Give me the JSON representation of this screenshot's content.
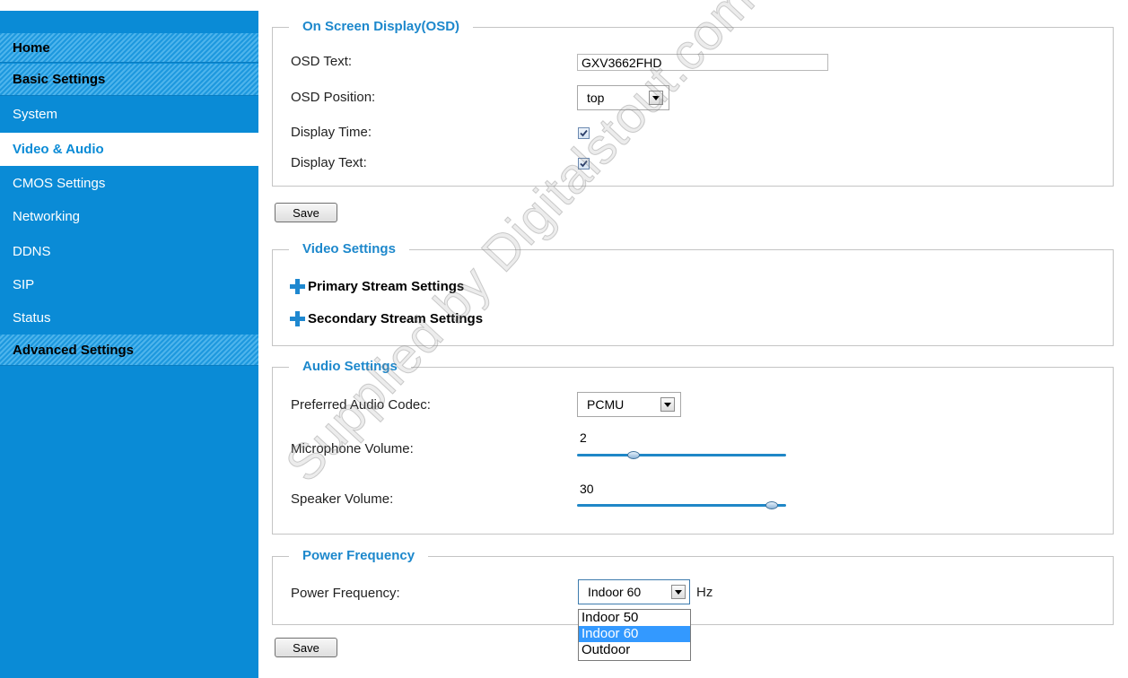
{
  "sidebar": {
    "items": [
      {
        "label": "Home"
      },
      {
        "label": "Basic Settings"
      },
      {
        "label": "System"
      },
      {
        "label": "Video & Audio"
      },
      {
        "label": "CMOS Settings"
      },
      {
        "label": "Networking"
      },
      {
        "label": "DDNS"
      },
      {
        "label": "SIP"
      },
      {
        "label": "Status"
      },
      {
        "label": "Advanced Settings"
      }
    ]
  },
  "osd": {
    "legend": "On Screen Display(OSD)",
    "text_label": "OSD Text:",
    "text_value": "GXV3662FHD",
    "position_label": "OSD Position:",
    "position_value": "top",
    "display_time_label": "Display Time:",
    "display_time_checked": true,
    "display_text_label": "Display Text:",
    "display_text_checked": true
  },
  "save_label": "Save",
  "video": {
    "legend": "Video Settings",
    "primary_label": "Primary Stream Settings",
    "secondary_label": "Secondary Stream Settings"
  },
  "audio": {
    "legend": "Audio Settings",
    "codec_label": "Preferred Audio Codec:",
    "codec_value": "PCMU",
    "mic_label": "Microphone Volume:",
    "mic_value": "2",
    "mic_fraction": 0.27,
    "speaker_label": "Speaker Volume:",
    "speaker_value": "30",
    "speaker_fraction": 0.93
  },
  "power": {
    "legend": "Power Frequency",
    "label": "Power Frequency:",
    "value": "Indoor 60",
    "unit": "Hz",
    "options": [
      "Indoor 50",
      "Indoor 60",
      "Outdoor"
    ],
    "selected_option": "Indoor 60"
  },
  "watermark": "Supplied by Digitalstout.com UAE",
  "colors": {
    "sidebar_bg": "#0a8bd6",
    "accent": "#1d88cc",
    "selected_option": "#3399ff"
  }
}
